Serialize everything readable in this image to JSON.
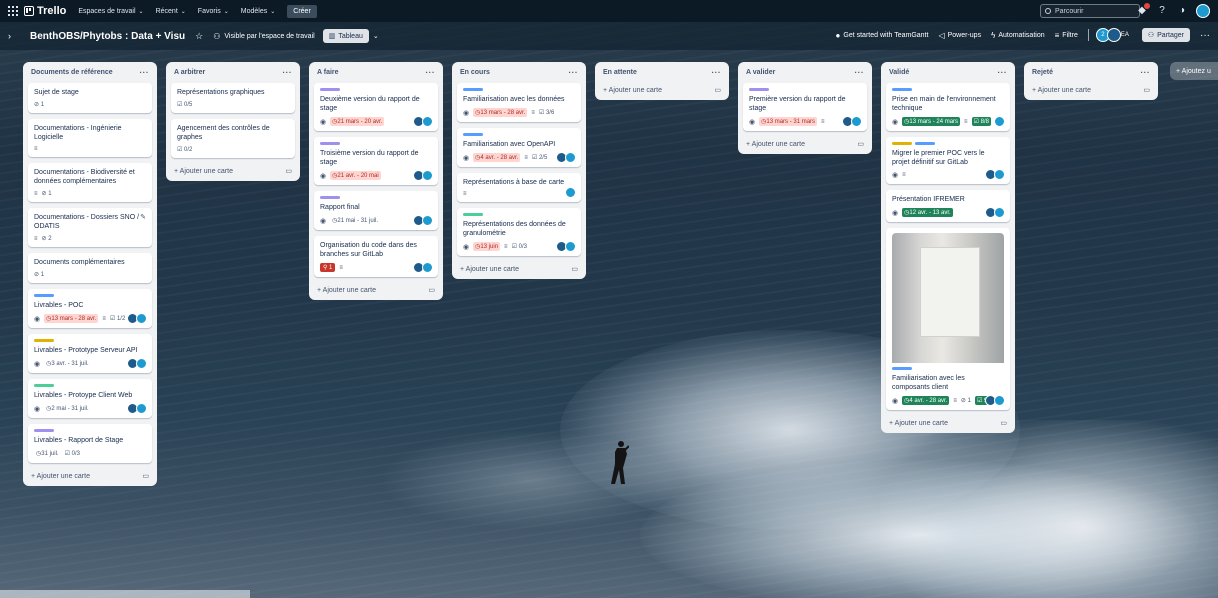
{
  "topnav": {
    "brand": "Trello",
    "menus": [
      "Espaces de travail",
      "Récent",
      "Favoris",
      "Modèles"
    ],
    "create": "Créer",
    "search_placeholder": "Parcourir"
  },
  "board": {
    "title": "BenthOBS/Phytobs : Data + Visu",
    "visibility": "Visible par l'espace de travail",
    "view": "Tableau",
    "actions": {
      "teamgantt": "Get started with TeamGantt",
      "powerups": "Power-ups",
      "automation": "Automatisation",
      "filter": "Filtre",
      "share": "Partager",
      "member_count": "2",
      "member_initials": "EA"
    },
    "add_list": "+ Ajoutez u"
  },
  "colors": {
    "purple": "#9f8fef",
    "blue": "#579dff",
    "yellow": "#e2b203",
    "green": "#4bce97",
    "avatar_dark": "#1e5a8a",
    "avatar_teal": "#1d9bd1"
  },
  "lists": [
    {
      "title": "Documents de référence",
      "add": "Ajouter une carte",
      "cards": [
        {
          "title": "Sujet de stage",
          "attach": "1"
        },
        {
          "title": "Documentations - Ingénierie Logicielle",
          "desc": true
        },
        {
          "title": "Documentations - Biodiversité et données complémentaires",
          "desc": true,
          "attach": "1"
        },
        {
          "title": "Documentations - Dossiers SNO / ODATIS",
          "desc": true,
          "attach": "2",
          "edit": true
        },
        {
          "title": "Documents complémentaires",
          "attach": "1"
        },
        {
          "title": "Livrables - POC",
          "label": "blue",
          "date": "13 mars - 28 avr.",
          "date_style": "due-red",
          "desc": true,
          "checklist": "1/2",
          "members": 2
        },
        {
          "title": "Livrables - Prototype Serveur API",
          "label": "yellow",
          "date": "3 avr. - 31 juil.",
          "members": 2
        },
        {
          "title": "Livrables - Protoype Client Web",
          "label": "green",
          "date": "2 mai - 31 juil.",
          "members": 2
        },
        {
          "title": "Livrables - Rapport de Stage",
          "label": "purple",
          "date_plain": "31 juil.",
          "checklist": "0/3"
        }
      ]
    },
    {
      "title": "A arbitrer",
      "add": "Ajouter une carte",
      "cards": [
        {
          "title": "Représentations graphiques",
          "checklist": "0/5"
        },
        {
          "title": "Agencement des contrôles de graphes",
          "checklist": "0/2"
        }
      ]
    },
    {
      "title": "A faire",
      "add": "Ajouter une carte",
      "cards": [
        {
          "title": "Deuxième version du rapport de stage",
          "label": "purple",
          "date": "21 mars - 20 avr.",
          "date_style": "due-red",
          "members": 2
        },
        {
          "title": "Troisième version du rapport de stage",
          "label": "purple",
          "date": "21 avr. - 20 mai",
          "date_style": "due-red",
          "members": 2
        },
        {
          "title": "Rapport final",
          "label": "purple",
          "date": "21 mai - 31 juil.",
          "members": 2
        },
        {
          "title": "Organisation du code dans des branches sur GitLab",
          "alert": "1",
          "desc": true,
          "members": 2
        }
      ]
    },
    {
      "title": "En cours",
      "add": "Ajouter une carte",
      "cards": [
        {
          "title": "Familiarisation avec les données",
          "label": "blue",
          "date": "13 mars - 28 avr.",
          "date_style": "due-red",
          "desc": true,
          "checklist": "3/6"
        },
        {
          "title": "Familiarisation avec OpenAPI",
          "label": "blue",
          "date": "4 avr. - 28 avr.",
          "date_style": "due-red",
          "desc": true,
          "checklist": "2/5",
          "members": 2
        },
        {
          "title": "Représentations à base de carte",
          "desc": true,
          "members": 1
        },
        {
          "title": "Représentations des données de granulométrie",
          "label": "green",
          "date": "13 juin",
          "date_style": "due-red",
          "desc": true,
          "checklist": "0/3",
          "members": 2
        }
      ]
    },
    {
      "title": "En attente",
      "add": "Ajouter une carte",
      "cards": []
    },
    {
      "title": "A valider",
      "add": "Ajouter une carte",
      "cards": [
        {
          "title": "Première version du rapport de stage",
          "label": "purple",
          "date": "13 mars - 31 mars",
          "date_style": "due-red",
          "desc": true,
          "members": 2
        }
      ]
    },
    {
      "title": "Validé",
      "add": "Ajouter une carte",
      "cards": [
        {
          "title": "Prise en main de l'environnement technique",
          "label": "blue",
          "date": "13 mars - 24 mars",
          "date_style": "done",
          "desc": true,
          "checklist_done": "8/8",
          "members": 1
        },
        {
          "title": "Migrer le premier POC vers le projet définitif sur GitLab",
          "labels": [
            "yellow",
            "blue"
          ],
          "desc": true,
          "members": 2
        },
        {
          "title": "Présentation IFREMER",
          "date": "12 avr. - 13 avr.",
          "date_style": "done",
          "members": 2
        },
        {
          "title": "Familiarisation avec les composants client",
          "image": true,
          "label": "blue",
          "date": "4 avr. - 28 avr.",
          "date_style": "done",
          "desc": true,
          "attach": "1",
          "checklist_done": "9/9",
          "members": 2
        }
      ]
    },
    {
      "title": "Rejeté",
      "add": "Ajouter une carte",
      "cards": []
    }
  ]
}
